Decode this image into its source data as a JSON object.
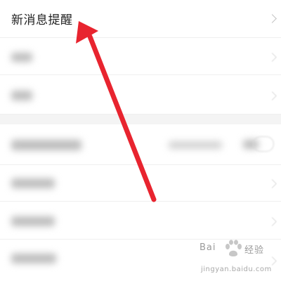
{
  "settings": {
    "new_message_label": "新消息提醒"
  },
  "watermark": {
    "brand_left": "Bai",
    "brand_right": "经验",
    "url": "jingyan.baidu.com"
  },
  "annotation": {
    "arrow_color": "#e8242f"
  }
}
